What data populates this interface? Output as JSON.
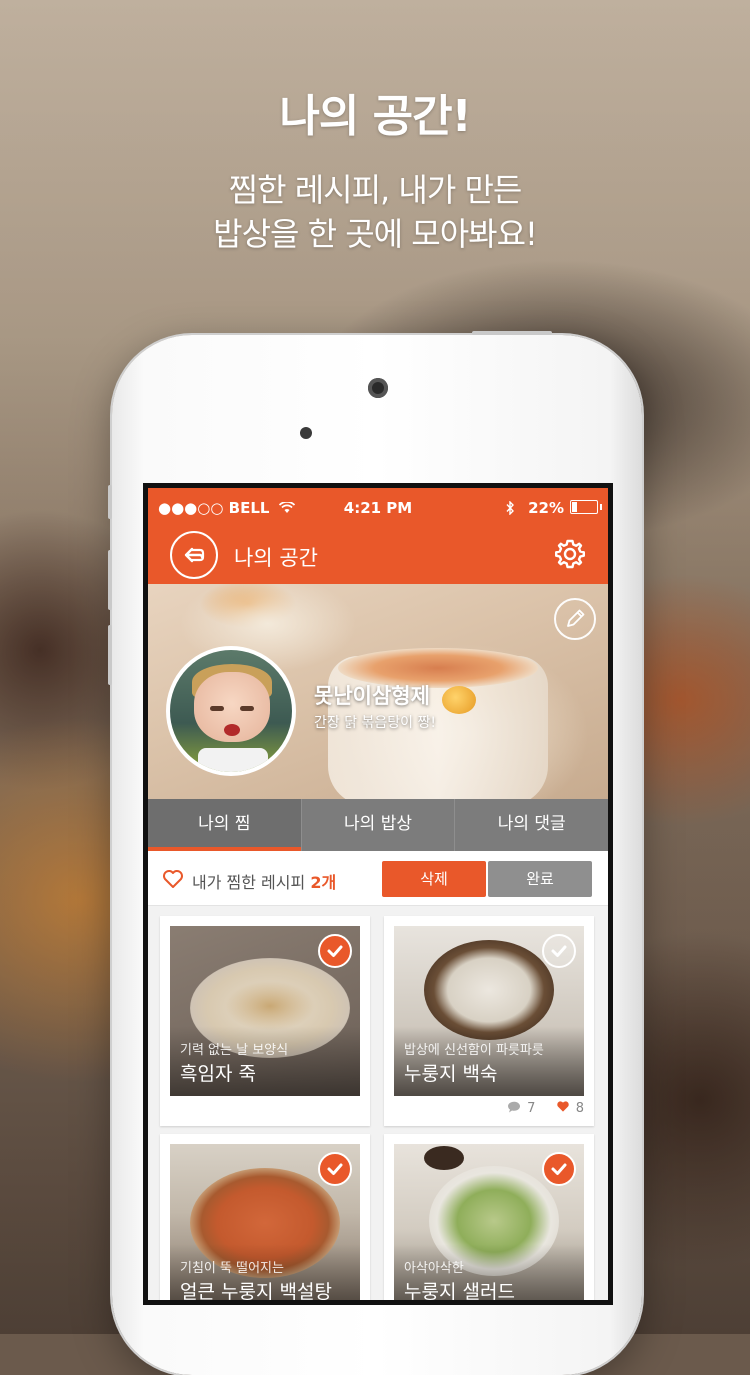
{
  "promo": {
    "headline": "나의 공간!",
    "subline_1": "찜한 레시피, 내가 만든",
    "subline_2": "밥상을 한 곳에 모아봐요!"
  },
  "statusbar": {
    "carrier": "●●●○○ BELL",
    "time": "4:21 PM",
    "battery": "22%",
    "battery_level": 0.22
  },
  "navbar": {
    "title": "나의 공간",
    "back_icon": "back-arrow-icon",
    "settings_icon": "gear-icon"
  },
  "profile": {
    "name": "못난이삼형제",
    "description": "간장 닭 볶음탕이 짱!"
  },
  "tabs": [
    {
      "label": "나의 찜",
      "active": true
    },
    {
      "label": "나의 밥상",
      "active": false
    },
    {
      "label": "나의 댓글",
      "active": false
    }
  ],
  "recipe_bar": {
    "label": "내가 찜한 레시피",
    "count": "2개",
    "delete_label": "삭제",
    "done_label": "완료"
  },
  "cards": [
    {
      "subtitle": "기력 없는 날 보양식",
      "title": "흑임자 죽",
      "checked": true,
      "comments": "",
      "likes": ""
    },
    {
      "subtitle": "밥상에 신선함이 파릇파릇",
      "title": "누룽지 백숙",
      "checked": false,
      "comments": "7",
      "likes": "8"
    },
    {
      "subtitle": "기침이 뚝 떨어지는",
      "title": "얼큰 누룽지 백설탕",
      "checked": true,
      "comments": "",
      "likes": ""
    },
    {
      "subtitle": "아삭아삭한",
      "title": "누룽지 샐러드",
      "checked": true,
      "comments": "",
      "likes": ""
    }
  ],
  "colors": {
    "accent": "#e9582a",
    "tab_bg": "#7c7c7c",
    "button_gray": "#8f8f8f"
  }
}
